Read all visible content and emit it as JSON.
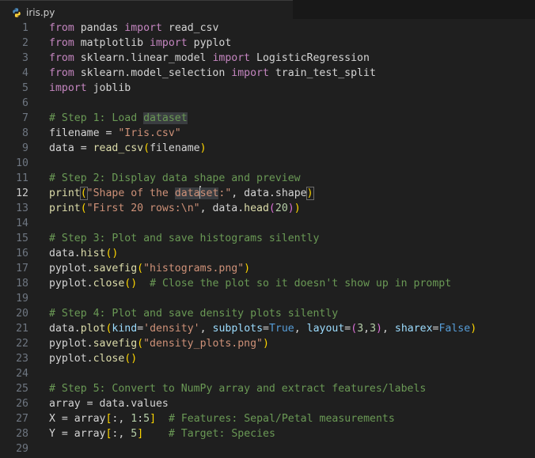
{
  "tab": {
    "filename": "iris.py"
  },
  "editor": {
    "active_line": 12,
    "lines": [
      {
        "n": "1",
        "segs": [
          [
            "kw",
            "from"
          ],
          [
            "op",
            " pandas "
          ],
          [
            "kw",
            "import"
          ],
          [
            "op",
            " read_csv"
          ]
        ]
      },
      {
        "n": "2",
        "segs": [
          [
            "kw",
            "from"
          ],
          [
            "op",
            " matplotlib "
          ],
          [
            "kw",
            "import"
          ],
          [
            "op",
            " pyplot"
          ]
        ]
      },
      {
        "n": "3",
        "segs": [
          [
            "kw",
            "from"
          ],
          [
            "op",
            " sklearn.linear_model "
          ],
          [
            "kw",
            "import"
          ],
          [
            "op",
            " LogisticRegression"
          ]
        ]
      },
      {
        "n": "4",
        "segs": [
          [
            "kw",
            "from"
          ],
          [
            "op",
            " sklearn.model_selection "
          ],
          [
            "kw",
            "import"
          ],
          [
            "op",
            " train_test_split"
          ]
        ]
      },
      {
        "n": "5",
        "segs": [
          [
            "kw",
            "import"
          ],
          [
            "op",
            " joblib"
          ]
        ]
      },
      {
        "n": "6",
        "segs": []
      },
      {
        "n": "7",
        "segs": [
          [
            "com",
            "# Step 1: Load "
          ],
          [
            "com hl",
            "dataset"
          ]
        ]
      },
      {
        "n": "8",
        "segs": [
          [
            "op",
            "filename = "
          ],
          [
            "str",
            "\"Iris.csv\""
          ]
        ]
      },
      {
        "n": "9",
        "segs": [
          [
            "op",
            "data = "
          ],
          [
            "fn",
            "read_csv"
          ],
          [
            "br",
            "("
          ],
          [
            "op",
            "filename"
          ],
          [
            "br",
            ")"
          ]
        ]
      },
      {
        "n": "10",
        "segs": []
      },
      {
        "n": "11",
        "segs": [
          [
            "com",
            "# Step 2: Display data shape and preview"
          ]
        ]
      },
      {
        "n": "12",
        "segs": [
          [
            "fn",
            "print"
          ],
          [
            "br hlbox",
            "("
          ],
          [
            "str",
            "\"Shape of the "
          ],
          [
            "str hl",
            "data"
          ],
          [
            "caret",
            ""
          ],
          [
            "str hl",
            "set"
          ],
          [
            "str",
            ":\""
          ],
          [
            "op",
            ", data.shape"
          ],
          [
            "br hlbox",
            ")"
          ]
        ]
      },
      {
        "n": "13",
        "segs": [
          [
            "fn",
            "print"
          ],
          [
            "br",
            "("
          ],
          [
            "str",
            "\"First 20 rows:\\n\""
          ],
          [
            "op",
            ", data."
          ],
          [
            "fn",
            "head"
          ],
          [
            "br2",
            "("
          ],
          [
            "num",
            "20"
          ],
          [
            "br2",
            ")"
          ],
          [
            "br",
            ")"
          ]
        ]
      },
      {
        "n": "14",
        "segs": []
      },
      {
        "n": "15",
        "segs": [
          [
            "com",
            "# Step 3: Plot and save histograms silently"
          ]
        ]
      },
      {
        "n": "16",
        "segs": [
          [
            "op",
            "data."
          ],
          [
            "fn",
            "hist"
          ],
          [
            "br",
            "()"
          ]
        ]
      },
      {
        "n": "17",
        "segs": [
          [
            "op",
            "pyplot."
          ],
          [
            "fn",
            "savefig"
          ],
          [
            "br",
            "("
          ],
          [
            "str",
            "\"histograms.png\""
          ],
          [
            "br",
            ")"
          ]
        ]
      },
      {
        "n": "18",
        "segs": [
          [
            "op",
            "pyplot."
          ],
          [
            "fn",
            "close"
          ],
          [
            "br",
            "()"
          ],
          [
            "op",
            "  "
          ],
          [
            "com",
            "# Close the plot so it doesn't show up in prompt"
          ]
        ]
      },
      {
        "n": "19",
        "segs": []
      },
      {
        "n": "20",
        "segs": [
          [
            "com",
            "# Step 4: Plot and save density plots silently"
          ]
        ]
      },
      {
        "n": "21",
        "segs": [
          [
            "op",
            "data."
          ],
          [
            "fn",
            "plot"
          ],
          [
            "br",
            "("
          ],
          [
            "var",
            "kind"
          ],
          [
            "op",
            "="
          ],
          [
            "str",
            "'density'"
          ],
          [
            "op",
            ", "
          ],
          [
            "var",
            "subplots"
          ],
          [
            "op",
            "="
          ],
          [
            "bool",
            "True"
          ],
          [
            "op",
            ", "
          ],
          [
            "var",
            "layout"
          ],
          [
            "op",
            "="
          ],
          [
            "br2",
            "("
          ],
          [
            "num",
            "3"
          ],
          [
            "op",
            ","
          ],
          [
            "num",
            "3"
          ],
          [
            "br2",
            ")"
          ],
          [
            "op",
            ", "
          ],
          [
            "var",
            "sharex"
          ],
          [
            "op",
            "="
          ],
          [
            "bool",
            "False"
          ],
          [
            "br",
            ")"
          ]
        ]
      },
      {
        "n": "22",
        "segs": [
          [
            "op",
            "pyplot."
          ],
          [
            "fn",
            "savefig"
          ],
          [
            "br",
            "("
          ],
          [
            "str",
            "\"density_plots.png\""
          ],
          [
            "br",
            ")"
          ]
        ]
      },
      {
        "n": "23",
        "segs": [
          [
            "op",
            "pyplot."
          ],
          [
            "fn",
            "close"
          ],
          [
            "br",
            "()"
          ]
        ]
      },
      {
        "n": "24",
        "segs": []
      },
      {
        "n": "25",
        "segs": [
          [
            "com",
            "# Step 5: Convert to NumPy array and extract features/labels"
          ]
        ]
      },
      {
        "n": "26",
        "segs": [
          [
            "op",
            "array = data.values"
          ]
        ]
      },
      {
        "n": "27",
        "segs": [
          [
            "op",
            "X = array"
          ],
          [
            "br",
            "["
          ],
          [
            "op",
            ":, "
          ],
          [
            "num",
            "1"
          ],
          [
            "op",
            ":"
          ],
          [
            "num",
            "5"
          ],
          [
            "br",
            "]"
          ],
          [
            "op",
            "  "
          ],
          [
            "com",
            "# Features: Sepal/Petal measurements"
          ]
        ]
      },
      {
        "n": "28",
        "segs": [
          [
            "op",
            "Y = array"
          ],
          [
            "br",
            "["
          ],
          [
            "op",
            ":, "
          ],
          [
            "num",
            "5"
          ],
          [
            "br",
            "]"
          ],
          [
            "op",
            "    "
          ],
          [
            "com",
            "# Target: Species"
          ]
        ]
      },
      {
        "n": "29",
        "segs": []
      }
    ]
  }
}
